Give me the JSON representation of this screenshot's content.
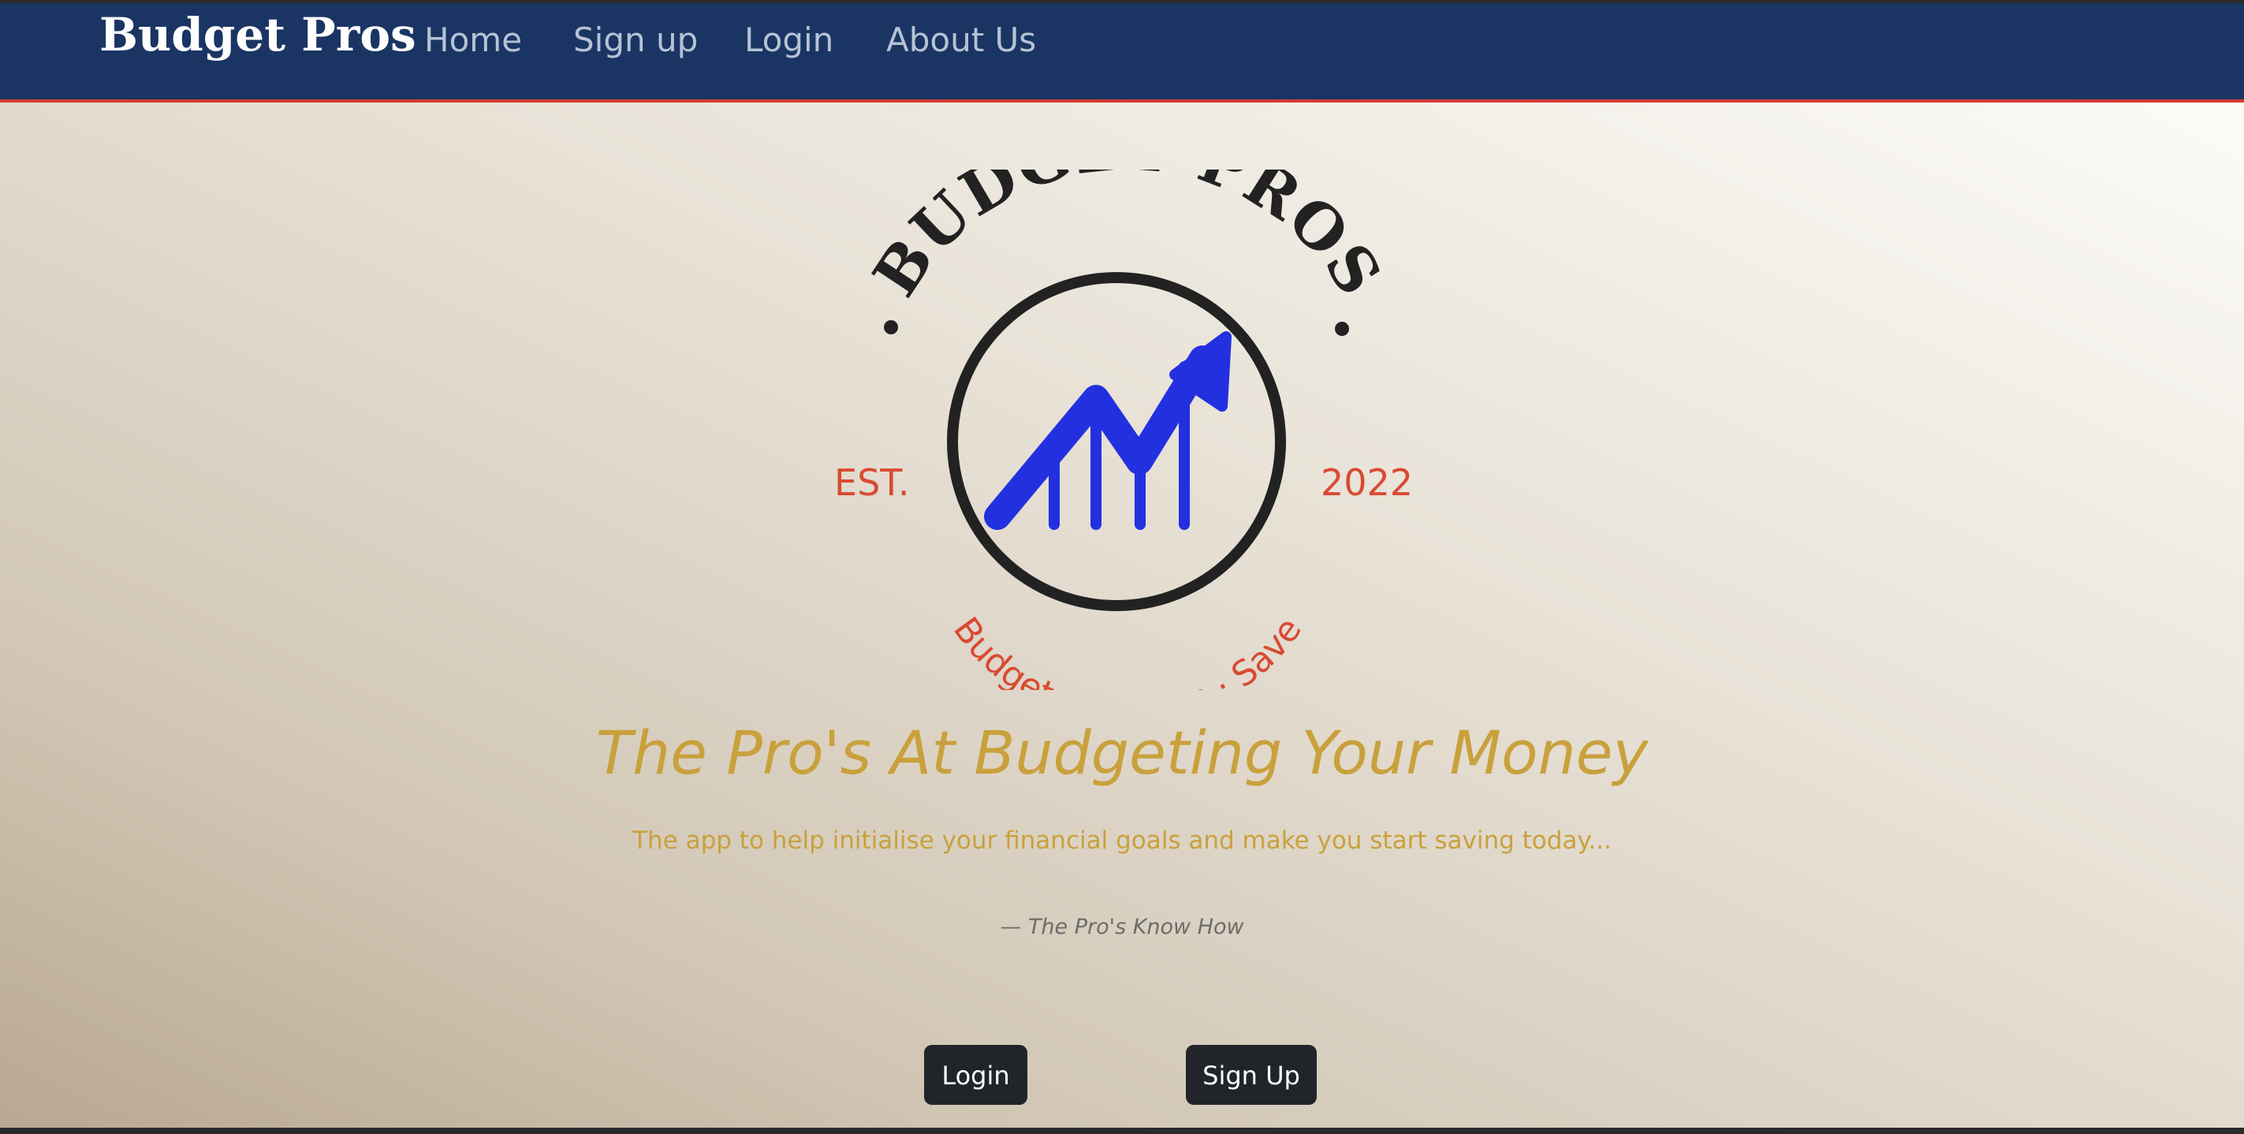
{
  "navbar": {
    "brand": "Budget Pros",
    "links": [
      "Home",
      "Sign up",
      "Login",
      "About Us"
    ],
    "background": "#1a3563",
    "accent": "#d83a32"
  },
  "logo": {
    "arc_text": "BUDGET PROS",
    "est_label": "EST.",
    "year": "2022",
    "tagline": "Budget · Manage · Save",
    "icon": "rising-chart-arrow-icon",
    "colors": {
      "ring": "#222222",
      "chart": "#2330e0",
      "accent_text": "#d94a32"
    }
  },
  "hero": {
    "headline": "The Pro's At Budgeting Your Money",
    "subline": "The app to help initialise your financial goals and make you start saving today...",
    "quote": "— The Pro's Know How",
    "headline_color": "#c9a13c"
  },
  "buttons": {
    "login": "Login",
    "signup": "Sign Up",
    "color": "#212529"
  }
}
